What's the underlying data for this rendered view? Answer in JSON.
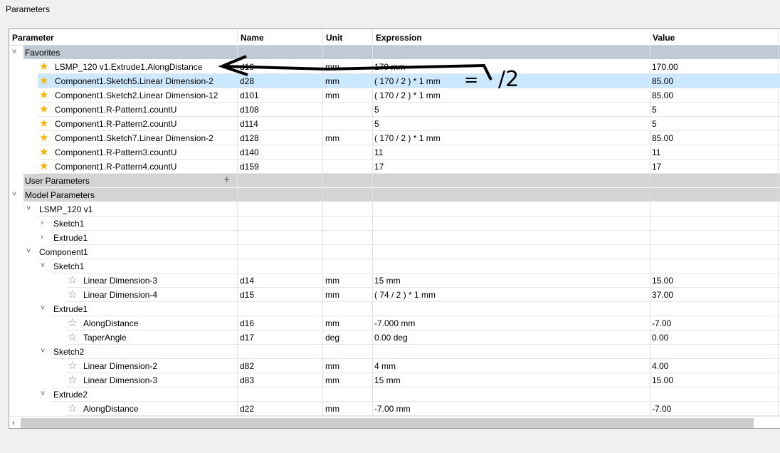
{
  "window_title": "Parameters",
  "columns": [
    "Parameter",
    "Name",
    "Unit",
    "Expression",
    "Value"
  ],
  "rows": [
    {
      "type": "group",
      "variant": "fav",
      "level": 0,
      "expanded": true,
      "label": "Favorites"
    },
    {
      "type": "param",
      "level": 2,
      "starred": true,
      "label": "LSMP_120 v1.Extrude1.AlongDistance",
      "name": "d10",
      "unit": "mm",
      "expression": "170 mm",
      "value": "170.00"
    },
    {
      "type": "param",
      "level": 2,
      "starred": true,
      "selected": true,
      "label": "Component1.Sketch5.Linear Dimension-2",
      "name": "d28",
      "unit": "mm",
      "expression": "( 170 / 2 ) * 1 mm",
      "value": "85.00"
    },
    {
      "type": "param",
      "level": 2,
      "starred": true,
      "label": "Component1.Sketch2.Linear Dimension-12",
      "name": "d101",
      "unit": "mm",
      "expression": "( 170 / 2 ) * 1 mm",
      "value": "85.00"
    },
    {
      "type": "param",
      "level": 2,
      "starred": true,
      "label": "Component1.R-Pattern1.countU",
      "name": "d108",
      "unit": "",
      "expression": "5",
      "value": "5"
    },
    {
      "type": "param",
      "level": 2,
      "starred": true,
      "label": "Component1.R-Pattern2.countU",
      "name": "d114",
      "unit": "",
      "expression": "5",
      "value": "5"
    },
    {
      "type": "param",
      "level": 2,
      "starred": true,
      "label": "Component1.Sketch7.Linear Dimension-2",
      "name": "d128",
      "unit": "mm",
      "expression": "( 170 / 2 ) * 1 mm",
      "value": "85.00"
    },
    {
      "type": "param",
      "level": 2,
      "starred": true,
      "label": "Component1.R-Pattern3.countU",
      "name": "d140",
      "unit": "",
      "expression": "11",
      "value": "11"
    },
    {
      "type": "param",
      "level": 2,
      "starred": true,
      "label": "Component1.R-Pattern4.countU",
      "name": "d159",
      "unit": "",
      "expression": "17",
      "value": "17"
    },
    {
      "type": "group",
      "level": 0,
      "label": "User Parameters",
      "add": "+"
    },
    {
      "type": "group",
      "level": 0,
      "expanded": true,
      "label": "Model Parameters"
    },
    {
      "type": "node",
      "level": 1,
      "expanded": true,
      "label": "LSMP_120 v1"
    },
    {
      "type": "node",
      "level": 2,
      "expanded": false,
      "label": "Sketch1"
    },
    {
      "type": "node",
      "level": 2,
      "expanded": false,
      "label": "Extrude1"
    },
    {
      "type": "node",
      "level": 1,
      "expanded": true,
      "label": "Component1"
    },
    {
      "type": "node",
      "level": 2,
      "expanded": true,
      "label": "Sketch1"
    },
    {
      "type": "param",
      "level": 3,
      "starred": false,
      "label": "Linear Dimension-3",
      "name": "d14",
      "unit": "mm",
      "expression": "15 mm",
      "value": "15.00"
    },
    {
      "type": "param",
      "level": 3,
      "starred": false,
      "label": "Linear Dimension-4",
      "name": "d15",
      "unit": "mm",
      "expression": "( 74 / 2 ) * 1 mm",
      "value": "37.00"
    },
    {
      "type": "node",
      "level": 2,
      "expanded": true,
      "label": "Extrude1"
    },
    {
      "type": "param",
      "level": 3,
      "starred": false,
      "label": "AlongDistance",
      "name": "d16",
      "unit": "mm",
      "expression": "-7.000 mm",
      "value": "-7.00"
    },
    {
      "type": "param",
      "level": 3,
      "starred": false,
      "label": "TaperAngle",
      "name": "d17",
      "unit": "deg",
      "expression": "0.00 deg",
      "value": "0.00"
    },
    {
      "type": "node",
      "level": 2,
      "expanded": true,
      "label": "Sketch2"
    },
    {
      "type": "param",
      "level": 3,
      "starred": false,
      "label": "Linear Dimension-2",
      "name": "d82",
      "unit": "mm",
      "expression": "4 mm",
      "value": "4.00"
    },
    {
      "type": "param",
      "level": 3,
      "starred": false,
      "label": "Linear Dimension-3",
      "name": "d83",
      "unit": "mm",
      "expression": "15 mm",
      "value": "15.00"
    },
    {
      "type": "node",
      "level": 2,
      "expanded": true,
      "label": "Extrude2"
    },
    {
      "type": "param",
      "level": 3,
      "starred": false,
      "label": "AlongDistance",
      "name": "d22",
      "unit": "mm",
      "expression": "-7.00 mm",
      "value": "-7.00"
    }
  ],
  "annotation": {
    "equals": "=",
    "divide": "/2"
  },
  "colors": {
    "selected": "#cce8ff",
    "favorites_header": "#c0cad5",
    "group_header": "#d4d4d4",
    "star": "#f5b400"
  }
}
